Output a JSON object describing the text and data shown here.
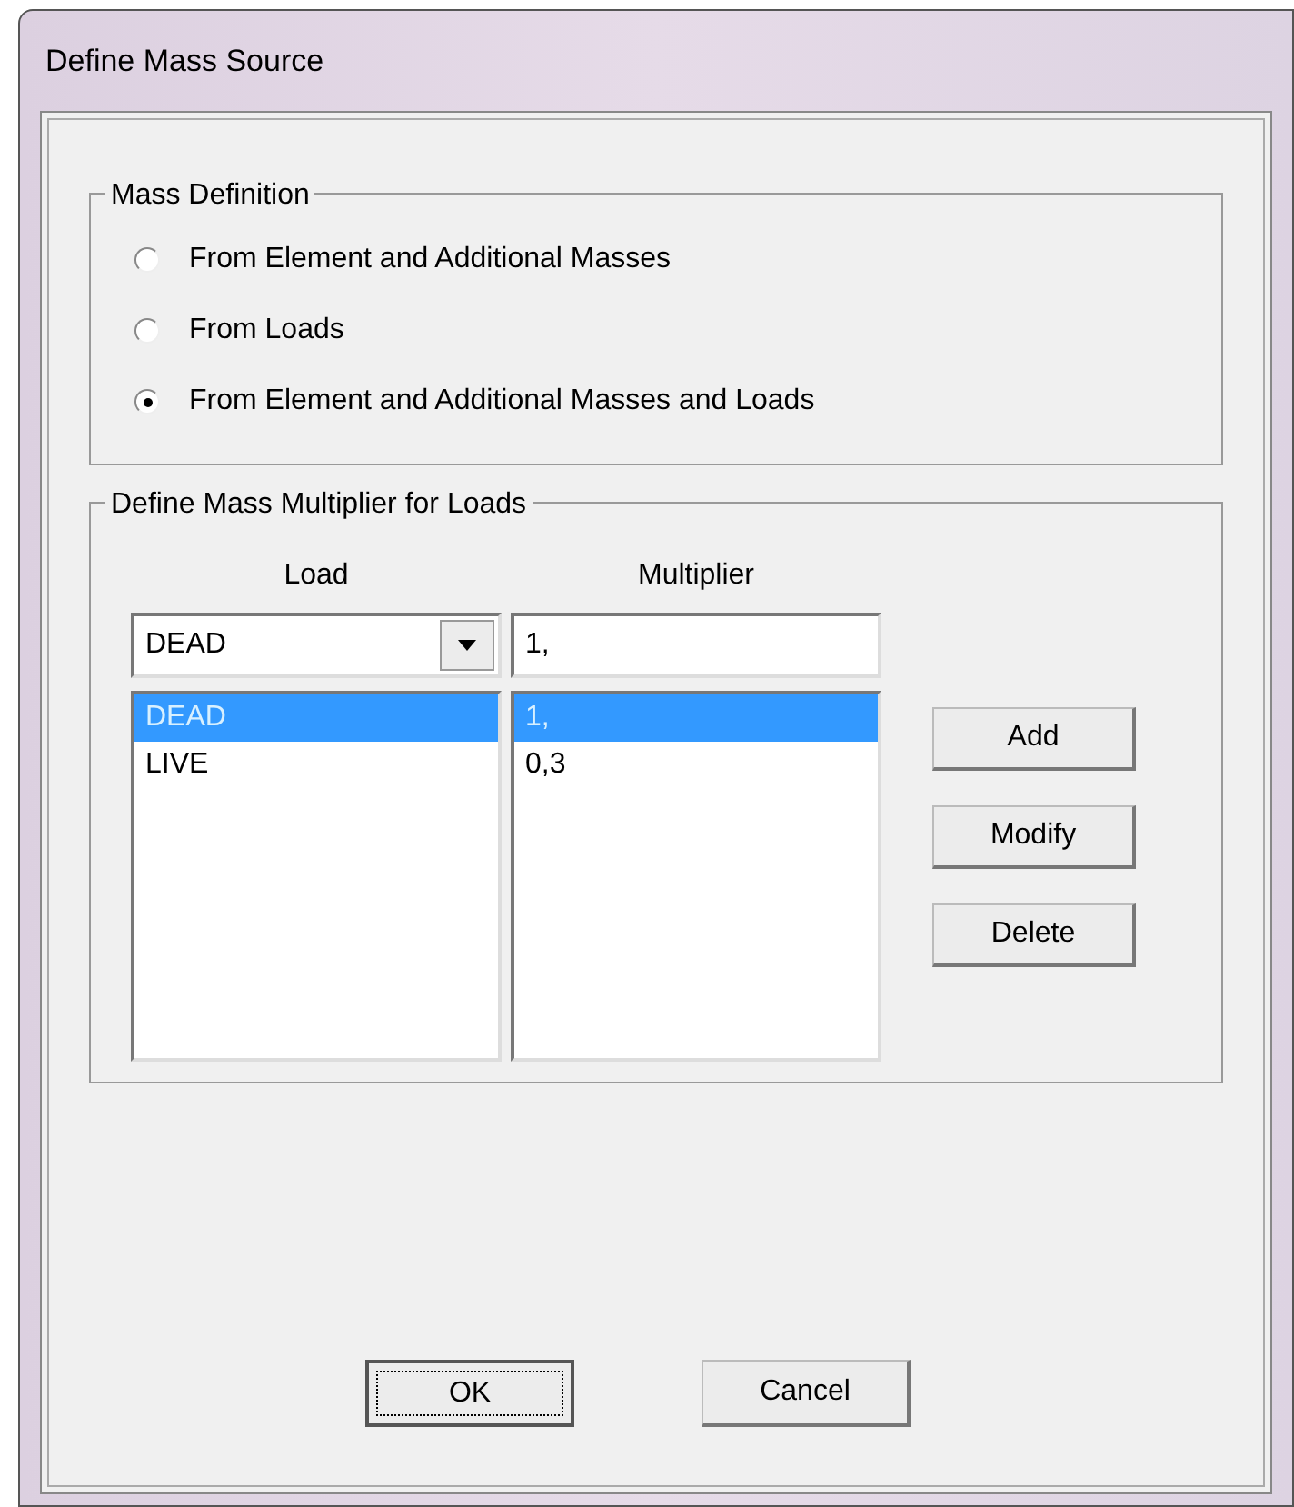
{
  "window": {
    "title": "Define Mass Source"
  },
  "mass_definition": {
    "title": "Mass Definition",
    "options": [
      {
        "label": "From Element and Additional Masses",
        "selected": false
      },
      {
        "label": "From Loads",
        "selected": false
      },
      {
        "label": "From Element and Additional Masses and Loads",
        "selected": true
      }
    ]
  },
  "mass_multiplier": {
    "title": "Define Mass Multiplier for Loads",
    "load_header": "Load",
    "multiplier_header": "Multiplier",
    "load_dropdown": {
      "value": "DEAD"
    },
    "multiplier_field": {
      "value": "1,"
    },
    "load_list": [
      {
        "label": "DEAD",
        "selected": true
      },
      {
        "label": "LIVE",
        "selected": false
      }
    ],
    "multiplier_list": [
      {
        "label": "1,",
        "selected": true
      },
      {
        "label": "0,3",
        "selected": false
      }
    ],
    "buttons": [
      "Add",
      "Modify",
      "Delete"
    ]
  },
  "buttons": [
    {
      "label": "OK",
      "focused": true
    },
    {
      "label": "Cancel",
      "focused": false
    }
  ]
}
